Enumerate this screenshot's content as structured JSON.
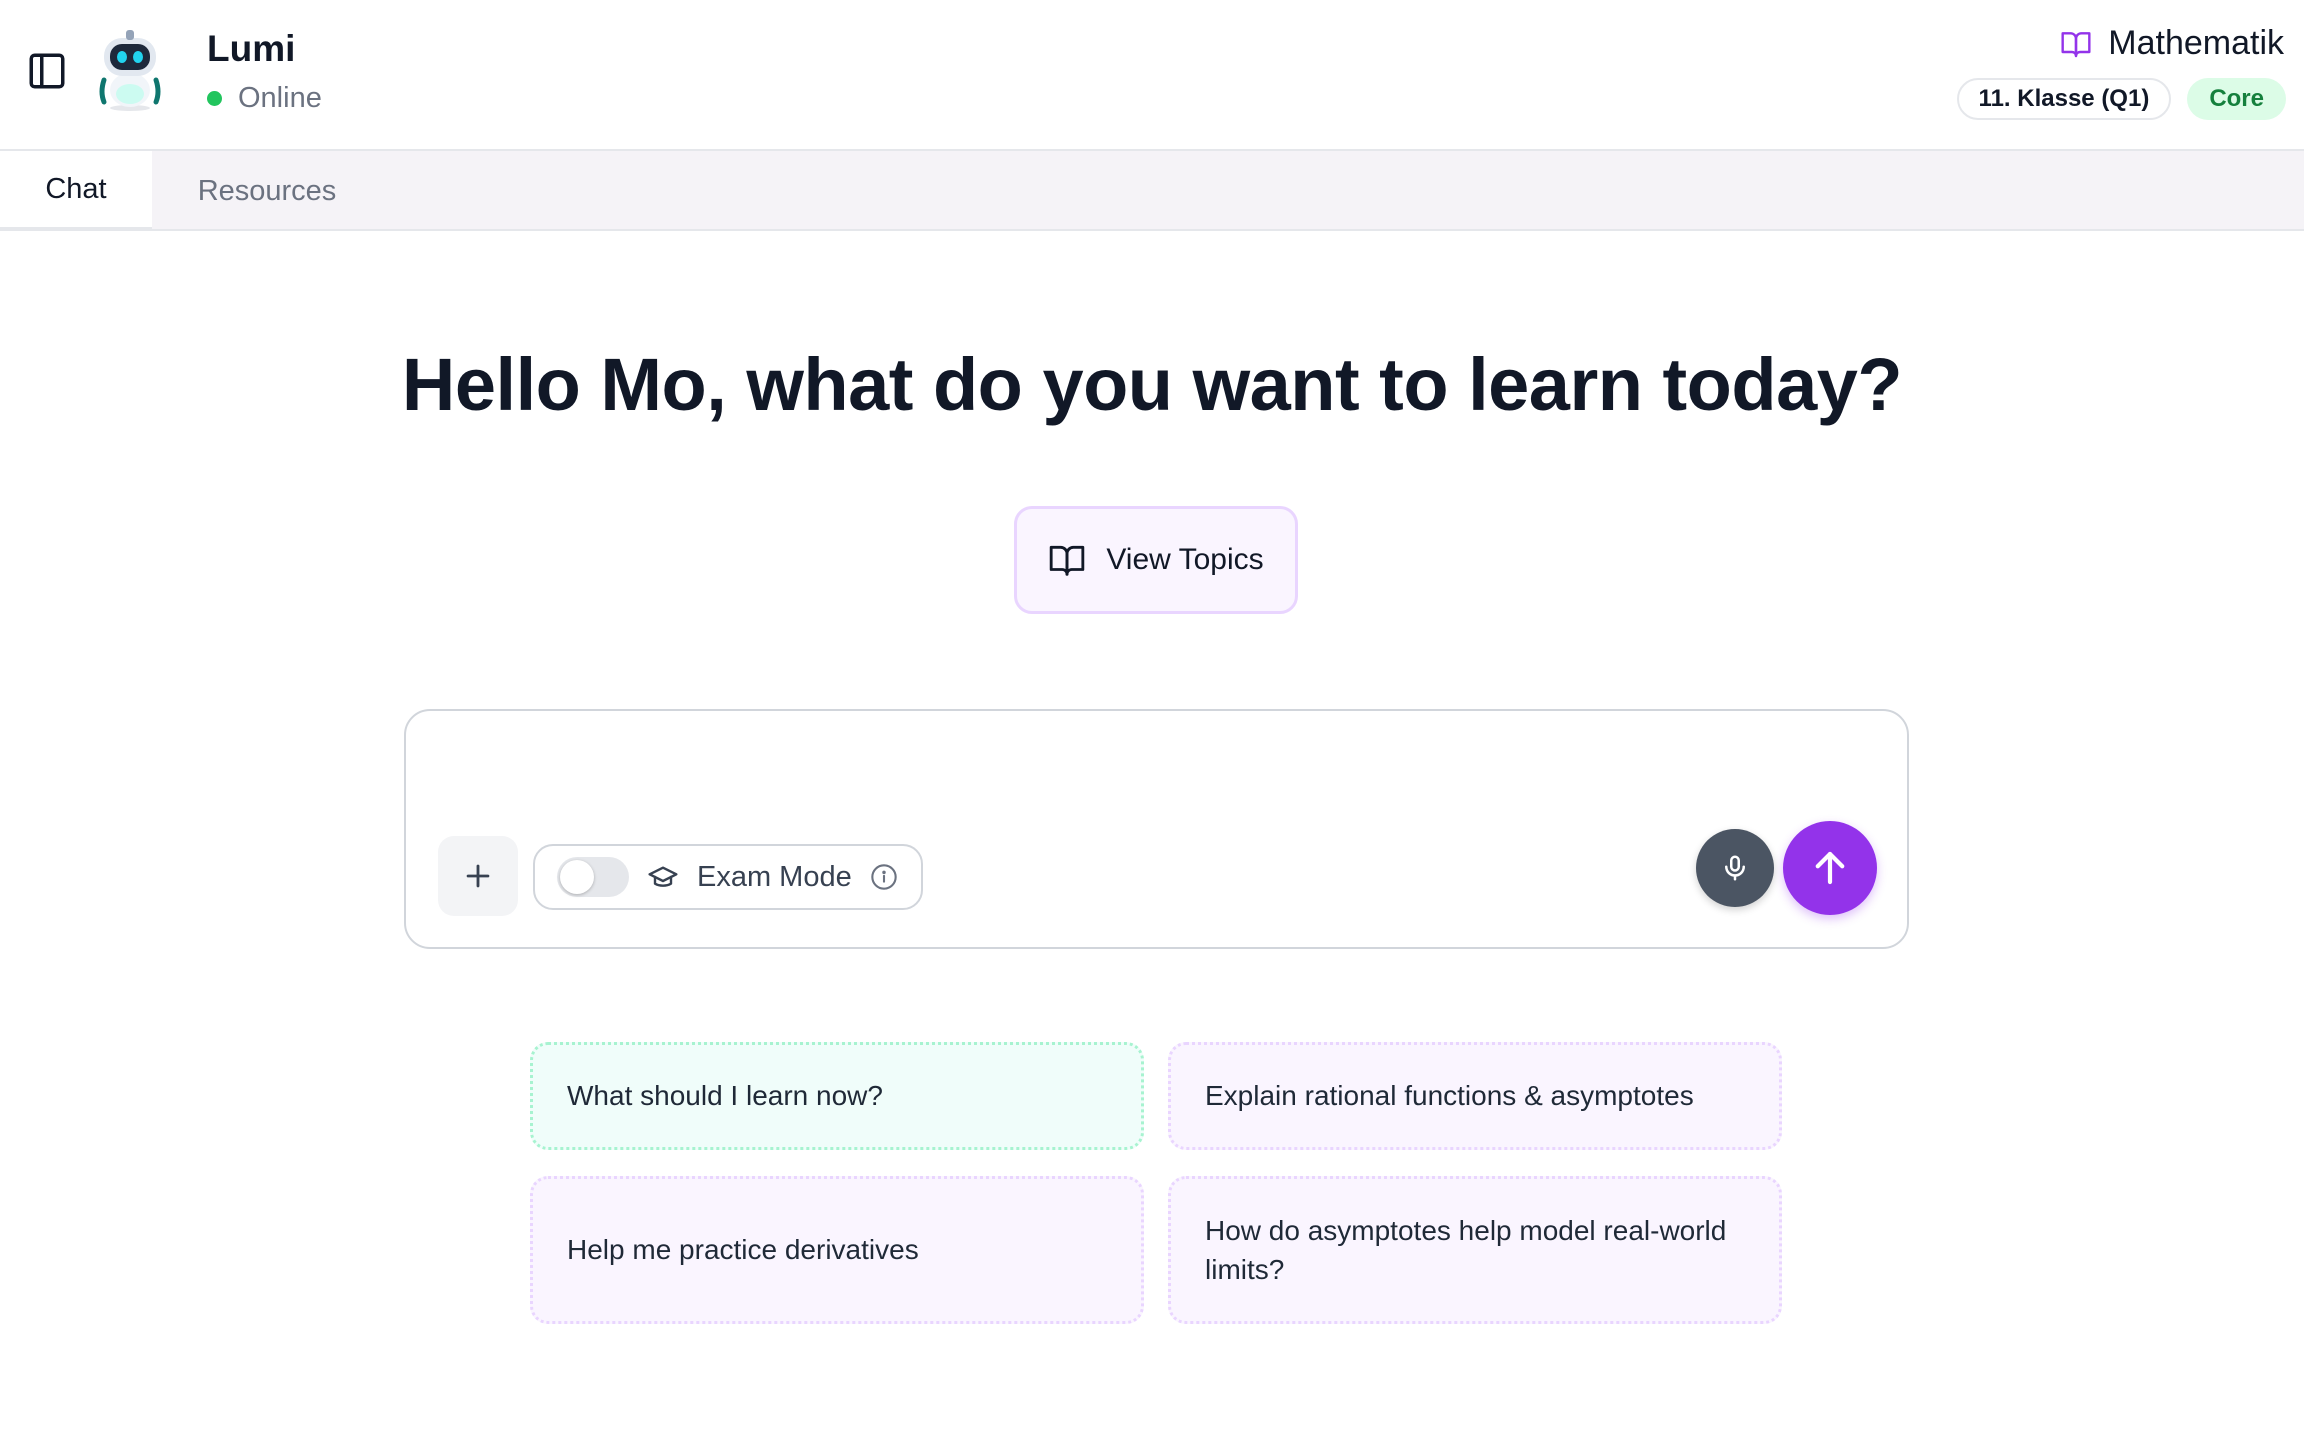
{
  "header": {
    "bot_name": "Lumi",
    "status": "Online",
    "subject": "Mathematik",
    "grade_badge": "11. Klasse (Q1)",
    "level_badge": "Core"
  },
  "tabs": [
    {
      "label": "Chat",
      "active": true
    },
    {
      "label": "Resources",
      "active": false
    }
  ],
  "main": {
    "greeting": "Hello Mo, what do you want to learn today?",
    "view_topics_label": "View Topics"
  },
  "composer": {
    "placeholder": "",
    "exam_mode_label": "Exam Mode",
    "exam_mode_enabled": false
  },
  "suggestions": [
    "What should I learn now?",
    "Explain rational functions & asymptotes",
    "Help me practice derivatives",
    "How do asymptotes help model real-world limits?"
  ],
  "icons": {
    "sidebar": "sidebar-toggle-icon",
    "subject": "book-open-icon",
    "add": "plus-icon",
    "exam": "graduation-cap-icon",
    "info": "info-icon",
    "mic": "microphone-icon",
    "send": "arrow-up-icon"
  },
  "colors": {
    "accent": "#9333ea",
    "online": "#22c55e",
    "core_badge_bg": "#dcfce7",
    "core_badge_text": "#15803d"
  }
}
